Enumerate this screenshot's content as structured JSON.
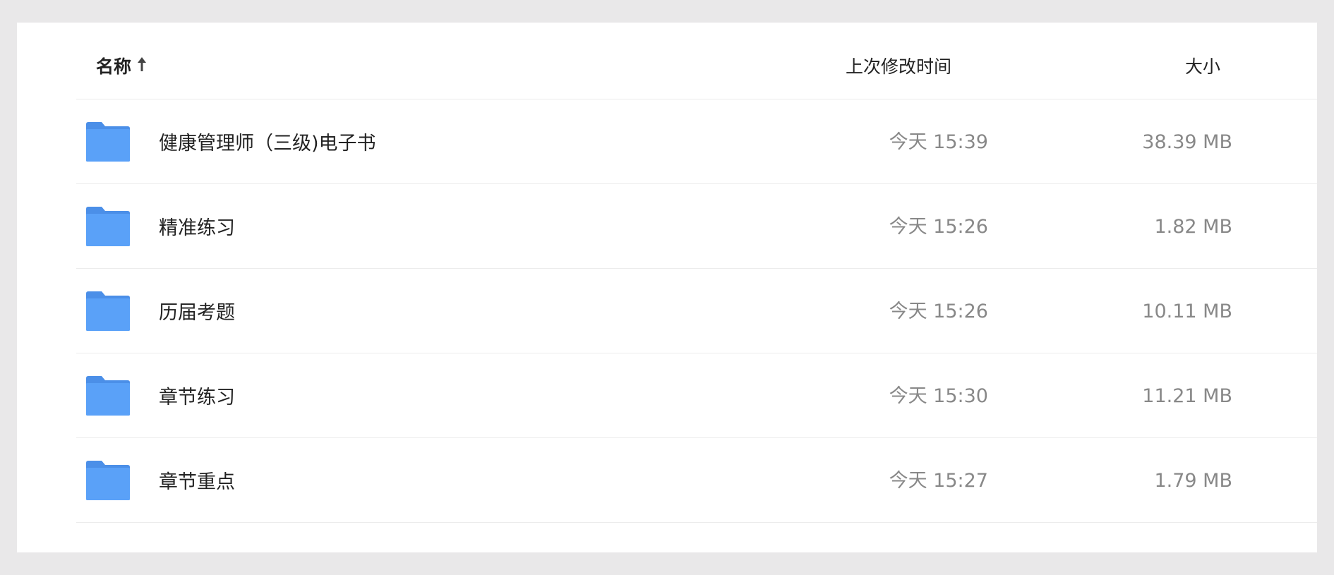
{
  "header": {
    "name_label": "名称",
    "time_label": "上次修改时间",
    "size_label": "大小",
    "sort_icon": "arrow-up-icon"
  },
  "colors": {
    "folder": "#5aa1f8",
    "folder_tab": "#4b8fe8",
    "primary_text": "#222222",
    "secondary_text": "#888888",
    "divider": "#ececec"
  },
  "files": [
    {
      "name": "健康管理师（三级)电子书",
      "modified": "今天 15:39",
      "size": "38.39 MB",
      "icon": "folder-icon"
    },
    {
      "name": "精准练习",
      "modified": "今天 15:26",
      "size": "1.82 MB",
      "icon": "folder-icon"
    },
    {
      "name": "历届考题",
      "modified": "今天 15:26",
      "size": "10.11 MB",
      "icon": "folder-icon"
    },
    {
      "name": "章节练习",
      "modified": "今天 15:30",
      "size": "11.21 MB",
      "icon": "folder-icon"
    },
    {
      "name": "章节重点",
      "modified": "今天 15:27",
      "size": "1.79 MB",
      "icon": "folder-icon"
    }
  ]
}
